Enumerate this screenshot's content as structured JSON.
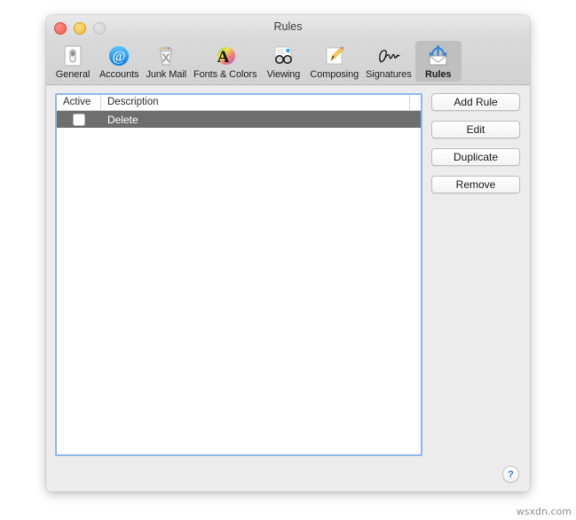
{
  "window": {
    "title": "Rules",
    "traffic_lights": [
      {
        "name": "close",
        "color": "#ec5f57"
      },
      {
        "name": "minimize",
        "color": "#f1bf3f"
      },
      {
        "name": "zoom",
        "color": "#d2d2d2"
      }
    ]
  },
  "toolbar": {
    "items": [
      {
        "label": "General",
        "icon": "general-switch-icon",
        "selected": false
      },
      {
        "label": "Accounts",
        "icon": "at-sign-icon",
        "selected": false
      },
      {
        "label": "Junk Mail",
        "icon": "trash-x-icon",
        "selected": false
      },
      {
        "label": "Fonts & Colors",
        "icon": "color-wheel-a-icon",
        "selected": false
      },
      {
        "label": "Viewing",
        "icon": "eyeglasses-icon",
        "selected": false
      },
      {
        "label": "Composing",
        "icon": "pencil-paper-icon",
        "selected": false
      },
      {
        "label": "Signatures",
        "icon": "signature-icon",
        "selected": false
      },
      {
        "label": "Rules",
        "icon": "rules-envelope-icon",
        "selected": true
      }
    ]
  },
  "table": {
    "columns": [
      "Active",
      "Description"
    ],
    "rows": [
      {
        "active": false,
        "description": "Delete",
        "selected": true
      }
    ]
  },
  "actions": {
    "buttons": [
      {
        "label": "Add Rule",
        "name": "add-rule-button"
      },
      {
        "label": "Edit",
        "name": "edit-button"
      },
      {
        "label": "Duplicate",
        "name": "duplicate-button"
      },
      {
        "label": "Remove",
        "name": "remove-button"
      }
    ]
  },
  "help": {
    "label": "?"
  },
  "watermark": {
    "text": "wsxdn.com"
  },
  "colors": {
    "focus_ring": "#8cb8e8",
    "selection_row": "#6e6e6e",
    "toolbar_selected": "#bfbfbf",
    "help_glyph": "#2a6fc4"
  }
}
